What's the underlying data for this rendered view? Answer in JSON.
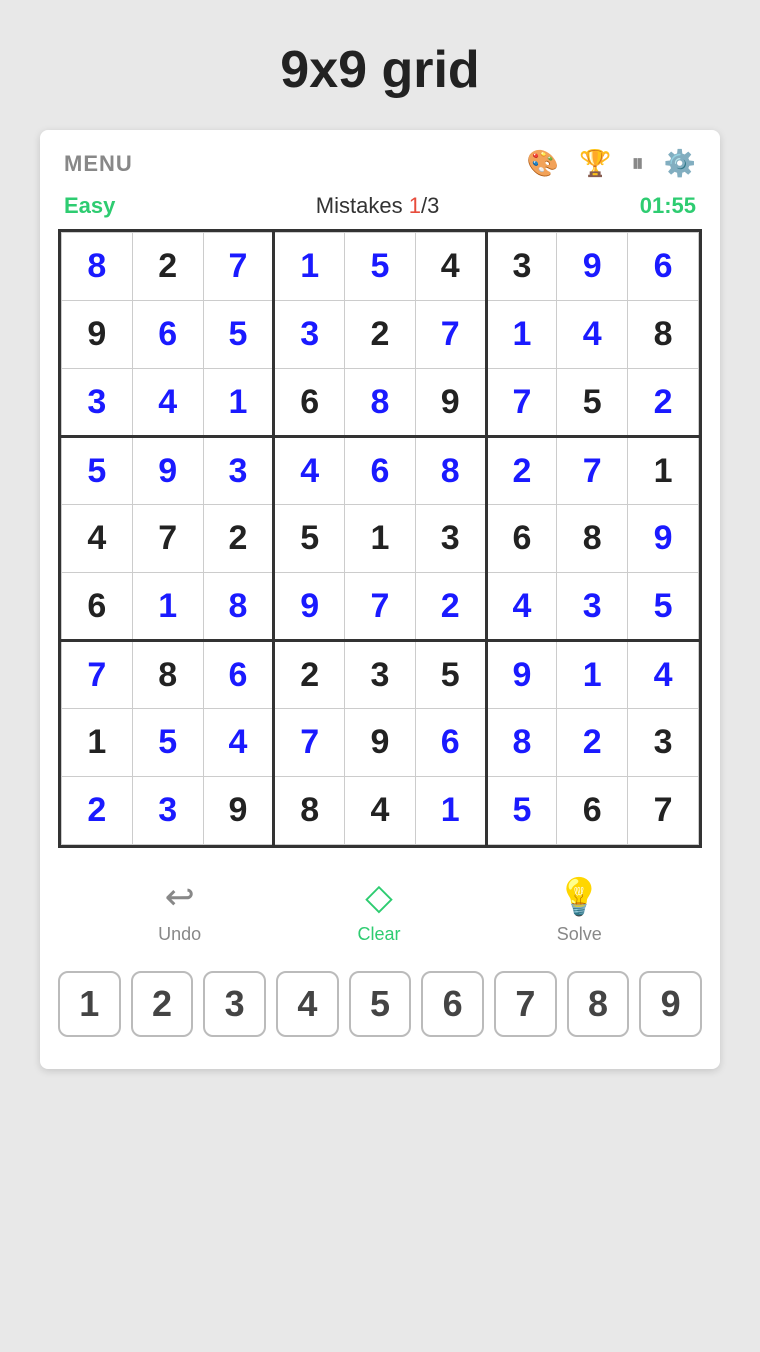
{
  "title": "9x9 grid",
  "menu": {
    "label": "MENU",
    "icons": [
      "palette-icon",
      "trophy-icon",
      "pause-icon",
      "settings-icon"
    ]
  },
  "info": {
    "difficulty": "Easy",
    "mistakes_label": "Mistakes ",
    "mistakes_current": "1",
    "mistakes_separator": "/",
    "mistakes_max": "3",
    "timer": "01:55"
  },
  "grid": [
    [
      {
        "v": "8",
        "c": "blue"
      },
      {
        "v": "2",
        "c": "black"
      },
      {
        "v": "7",
        "c": "blue"
      },
      {
        "v": "1",
        "c": "blue"
      },
      {
        "v": "5",
        "c": "blue"
      },
      {
        "v": "4",
        "c": "black"
      },
      {
        "v": "3",
        "c": "black"
      },
      {
        "v": "9",
        "c": "blue"
      },
      {
        "v": "6",
        "c": "blue"
      }
    ],
    [
      {
        "v": "9",
        "c": "black"
      },
      {
        "v": "6",
        "c": "blue"
      },
      {
        "v": "5",
        "c": "blue"
      },
      {
        "v": "3",
        "c": "blue"
      },
      {
        "v": "2",
        "c": "black"
      },
      {
        "v": "7",
        "c": "blue"
      },
      {
        "v": "1",
        "c": "blue"
      },
      {
        "v": "4",
        "c": "blue"
      },
      {
        "v": "8",
        "c": "black"
      }
    ],
    [
      {
        "v": "3",
        "c": "blue"
      },
      {
        "v": "4",
        "c": "blue"
      },
      {
        "v": "1",
        "c": "blue"
      },
      {
        "v": "6",
        "c": "black"
      },
      {
        "v": "8",
        "c": "blue"
      },
      {
        "v": "9",
        "c": "black"
      },
      {
        "v": "7",
        "c": "blue"
      },
      {
        "v": "5",
        "c": "black"
      },
      {
        "v": "2",
        "c": "blue"
      }
    ],
    [
      {
        "v": "5",
        "c": "blue"
      },
      {
        "v": "9",
        "c": "blue"
      },
      {
        "v": "3",
        "c": "blue"
      },
      {
        "v": "4",
        "c": "blue"
      },
      {
        "v": "6",
        "c": "blue"
      },
      {
        "v": "8",
        "c": "blue"
      },
      {
        "v": "2",
        "c": "blue"
      },
      {
        "v": "7",
        "c": "blue"
      },
      {
        "v": "1",
        "c": "black"
      }
    ],
    [
      {
        "v": "4",
        "c": "black"
      },
      {
        "v": "7",
        "c": "black"
      },
      {
        "v": "2",
        "c": "black"
      },
      {
        "v": "5",
        "c": "black"
      },
      {
        "v": "1",
        "c": "black"
      },
      {
        "v": "3",
        "c": "black"
      },
      {
        "v": "6",
        "c": "black"
      },
      {
        "v": "8",
        "c": "black"
      },
      {
        "v": "9",
        "c": "blue"
      }
    ],
    [
      {
        "v": "6",
        "c": "black"
      },
      {
        "v": "1",
        "c": "blue"
      },
      {
        "v": "8",
        "c": "blue"
      },
      {
        "v": "9",
        "c": "blue"
      },
      {
        "v": "7",
        "c": "blue"
      },
      {
        "v": "2",
        "c": "blue"
      },
      {
        "v": "4",
        "c": "blue"
      },
      {
        "v": "3",
        "c": "blue"
      },
      {
        "v": "5",
        "c": "blue"
      }
    ],
    [
      {
        "v": "7",
        "c": "blue"
      },
      {
        "v": "8",
        "c": "black"
      },
      {
        "v": "6",
        "c": "blue"
      },
      {
        "v": "2",
        "c": "black"
      },
      {
        "v": "3",
        "c": "black"
      },
      {
        "v": "5",
        "c": "black"
      },
      {
        "v": "9",
        "c": "blue"
      },
      {
        "v": "1",
        "c": "blue"
      },
      {
        "v": "4",
        "c": "blue"
      }
    ],
    [
      {
        "v": "1",
        "c": "black"
      },
      {
        "v": "5",
        "c": "blue"
      },
      {
        "v": "4",
        "c": "blue"
      },
      {
        "v": "7",
        "c": "blue"
      },
      {
        "v": "9",
        "c": "black"
      },
      {
        "v": "6",
        "c": "blue"
      },
      {
        "v": "8",
        "c": "blue"
      },
      {
        "v": "2",
        "c": "blue"
      },
      {
        "v": "3",
        "c": "black"
      }
    ],
    [
      {
        "v": "2",
        "c": "blue"
      },
      {
        "v": "3",
        "c": "blue"
      },
      {
        "v": "9",
        "c": "black"
      },
      {
        "v": "8",
        "c": "black"
      },
      {
        "v": "4",
        "c": "black"
      },
      {
        "v": "1",
        "c": "blue"
      },
      {
        "v": "5",
        "c": "blue"
      },
      {
        "v": "6",
        "c": "black"
      },
      {
        "v": "7",
        "c": "black"
      }
    ]
  ],
  "actions": {
    "undo_label": "Undo",
    "clear_label": "Clear",
    "solve_label": "Solve"
  },
  "numbers": [
    "1",
    "2",
    "3",
    "4",
    "5",
    "6",
    "7",
    "8",
    "9"
  ]
}
